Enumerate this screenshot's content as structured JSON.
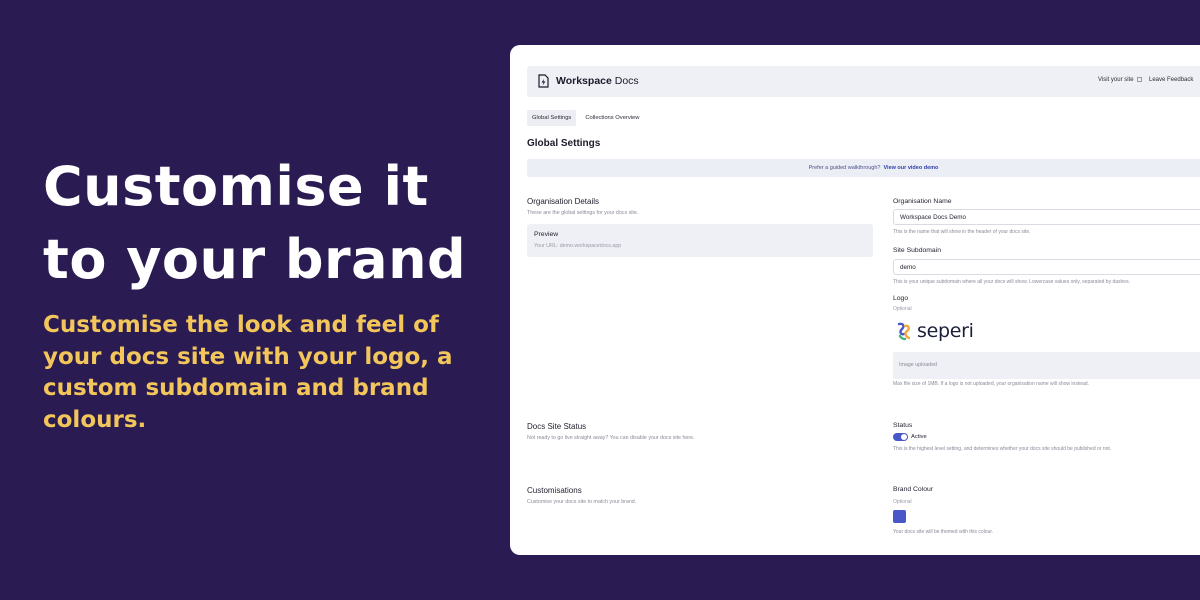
{
  "hero": {
    "title": "Customise it to your brand",
    "subtitle": "Customise the look and feel of your docs site with your logo, a custom subdomain and brand colours."
  },
  "app": {
    "logo": {
      "bold": "Workspace",
      "rest": " Docs",
      "icon": "doc-lightning-icon"
    },
    "nav": {
      "visit_site": "Visit your site",
      "feedback": "Leave Feedback"
    },
    "tabs": [
      {
        "label": "Global Settings",
        "active": true
      },
      {
        "label": "Collections Overview",
        "active": false
      }
    ],
    "page_title": "Global Settings",
    "banner": {
      "text": "Prefer a guided walkthrough?",
      "link": "View our video demo"
    },
    "org_details": {
      "title": "Organisation Details",
      "desc": "These are the global settings for your docs site.",
      "preview_title": "Preview",
      "preview_url": "Your URL: demo.workspacedocs.app"
    },
    "org_name": {
      "label": "Organisation Name",
      "value": "Workspace Docs Demo",
      "help": "This is the name that will show in the header of your docs site."
    },
    "subdomain": {
      "label": "Site Subdomain",
      "value": "demo",
      "help": "This is your unique subdomain where all your docs will show. Lowercase values only, separated by dashes."
    },
    "logo_field": {
      "label": "Logo",
      "optional": "Optional",
      "brand_name": "seperi",
      "uploaded": "Image uploaded",
      "help": "Max file size of 1MB. If a logo is not uploaded, your organisation name will show instead."
    },
    "site_status": {
      "title": "Docs Site Status",
      "desc": "Not ready to go live straight away? You can disable your docs site here.",
      "label": "Status",
      "toggle_label": "Active",
      "help": "This is the highest level setting, and determines whether your docs site should be published or not."
    },
    "customisations": {
      "title": "Customisations",
      "desc": "Customise your docs site to match your brand.",
      "label": "Brand Colour",
      "optional": "Optional",
      "help": "Your docs site will be themed with this colour."
    }
  },
  "colors": {
    "background": "#2a1b52",
    "hero_subtitle": "#f2c65a",
    "accent": "#4a57c9"
  }
}
